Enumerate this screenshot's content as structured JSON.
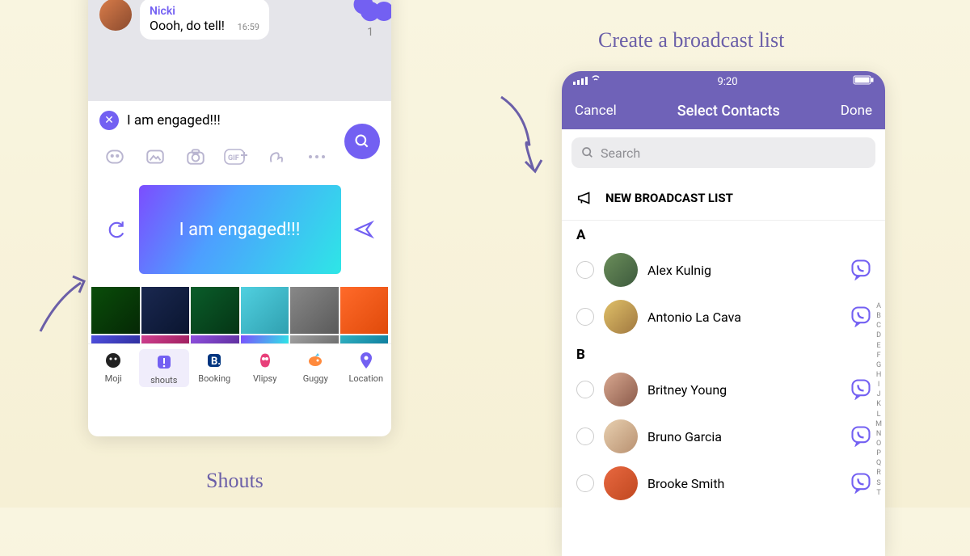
{
  "captions": {
    "left": "Shouts",
    "right": "Create a broadcast list"
  },
  "chat": {
    "sender": "Nicki",
    "text": "Oooh, do tell!",
    "time": "16:59",
    "reaction_count": "1"
  },
  "composer": {
    "input": "I am engaged!!!",
    "preview": "I am engaged!!!"
  },
  "nav_items": [
    {
      "label": "Moji"
    },
    {
      "label": "shouts"
    },
    {
      "label": "Booking"
    },
    {
      "label": "Vlipsy"
    },
    {
      "label": "Guggy"
    },
    {
      "label": "Location"
    }
  ],
  "right_phone": {
    "time": "9:20",
    "cancel": "Cancel",
    "title": "Select Contacts",
    "done": "Done",
    "search_placeholder": "Search",
    "broadcast": "NEW BROADCAST LIST",
    "sections": [
      {
        "letter": "A",
        "contacts": [
          {
            "name": "Alex Kulnig",
            "av": "linear-gradient(135deg,#6b8e5a,#3d5a3d)"
          },
          {
            "name": "Antonio La Cava",
            "av": "linear-gradient(135deg,#e0c068,#a07840)"
          }
        ]
      },
      {
        "letter": "B",
        "contacts": [
          {
            "name": "Britney Young",
            "av": "linear-gradient(135deg,#d8a890,#8b5a4a)"
          },
          {
            "name": "Bruno Garcia",
            "av": "linear-gradient(135deg,#e8d0b0,#b89070)"
          },
          {
            "name": "Brooke Smith",
            "av": "linear-gradient(135deg,#e86840,#c04820)"
          }
        ]
      }
    ],
    "index": [
      "A",
      "B",
      "C",
      "D",
      "E",
      "F",
      "G",
      "H",
      "I",
      "J",
      "K",
      "L",
      "M",
      "N",
      "O",
      "P",
      "Q",
      "R",
      "S",
      "T"
    ]
  },
  "tiles": [
    "linear-gradient(135deg,#0a4d0a,#052805)",
    "linear-gradient(135deg,#1a2850,#0a1530)",
    "linear-gradient(135deg,#0a5d2a,#053515)",
    "linear-gradient(135deg,#50d0e0,#30a0b0)",
    "linear-gradient(135deg,#888,#5a5a5a)",
    "linear-gradient(135deg,#ff6a2a,#e04a0a)"
  ],
  "tiles2": [
    "linear-gradient(135deg,#5050e0,#3030a0)",
    "linear-gradient(135deg,#d04090,#a02060)",
    "linear-gradient(135deg,#9050e0,#6030a0)",
    "linear-gradient(120deg,#7c4dff,#2ee6e6)",
    "linear-gradient(135deg,#a0a0a0,#707070)",
    "linear-gradient(135deg,#30b0c0,#1080a0)"
  ]
}
